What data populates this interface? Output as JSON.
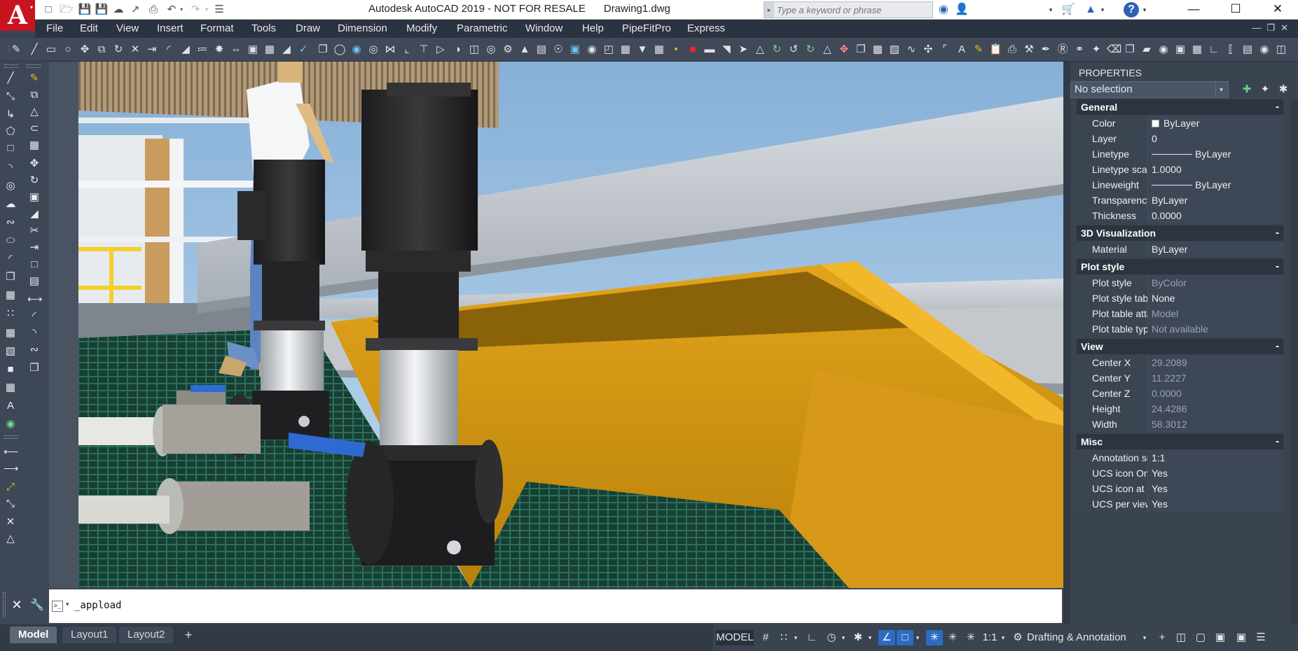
{
  "window": {
    "title": "Autodesk AutoCAD 2019 - NOT FOR RESALE",
    "drawing": "Drawing1.dwg",
    "search_placeholder": "Type a keyword or phrase"
  },
  "menu": [
    "File",
    "Edit",
    "View",
    "Insert",
    "Format",
    "Tools",
    "Draw",
    "Dimension",
    "Modify",
    "Parametric",
    "Window",
    "Help",
    "PipeFitPro",
    "Express"
  ],
  "command_line": {
    "input_value": "_appload"
  },
  "layout_tabs": {
    "model": "Model",
    "layout1": "Layout1",
    "layout2": "Layout2"
  },
  "status_bar": {
    "space": "MODEL",
    "scale": "1:1",
    "workspace": "Drafting & Annotation"
  },
  "properties": {
    "title": "PROPERTIES",
    "selection": "No selection",
    "collapse_glyph": "-",
    "sections": {
      "general": {
        "title": "General",
        "rows": [
          {
            "label": "Color",
            "value": "ByLayer"
          },
          {
            "label": "Layer",
            "value": "0"
          },
          {
            "label": "Linetype",
            "value": "ByLayer"
          },
          {
            "label": "Linetype scale",
            "value": "1.0000"
          },
          {
            "label": "Lineweight",
            "value": "ByLayer"
          },
          {
            "label": "Transparency",
            "value": "ByLayer"
          },
          {
            "label": "Thickness",
            "value": "0.0000"
          }
        ]
      },
      "viz": {
        "title": "3D Visualization",
        "rows": [
          {
            "label": "Material",
            "value": "ByLayer"
          }
        ]
      },
      "plot": {
        "title": "Plot style",
        "rows": [
          {
            "label": "Plot style",
            "value": "ByColor"
          },
          {
            "label": "Plot style table",
            "value": "None"
          },
          {
            "label": "Plot table atta...",
            "value": "Model"
          },
          {
            "label": "Plot table type",
            "value": "Not available"
          }
        ]
      },
      "view": {
        "title": "View",
        "rows": [
          {
            "label": "Center X",
            "value": "29.2089"
          },
          {
            "label": "Center Y",
            "value": "11.2227"
          },
          {
            "label": "Center Z",
            "value": "0.0000"
          },
          {
            "label": "Height",
            "value": "24.4286"
          },
          {
            "label": "Width",
            "value": "58.3012"
          }
        ]
      },
      "misc": {
        "title": "Misc",
        "rows": [
          {
            "label": "Annotation sc...",
            "value": "1:1"
          },
          {
            "label": "UCS icon On",
            "value": "Yes"
          },
          {
            "label": "UCS icon at ori...",
            "value": "Yes"
          },
          {
            "label": "UCS per viewp...",
            "value": "Yes"
          }
        ]
      }
    }
  },
  "colors": {
    "accent_red": "#c8141e",
    "panel_dark": "#3a4350",
    "status_on": "#2c6cc2"
  }
}
